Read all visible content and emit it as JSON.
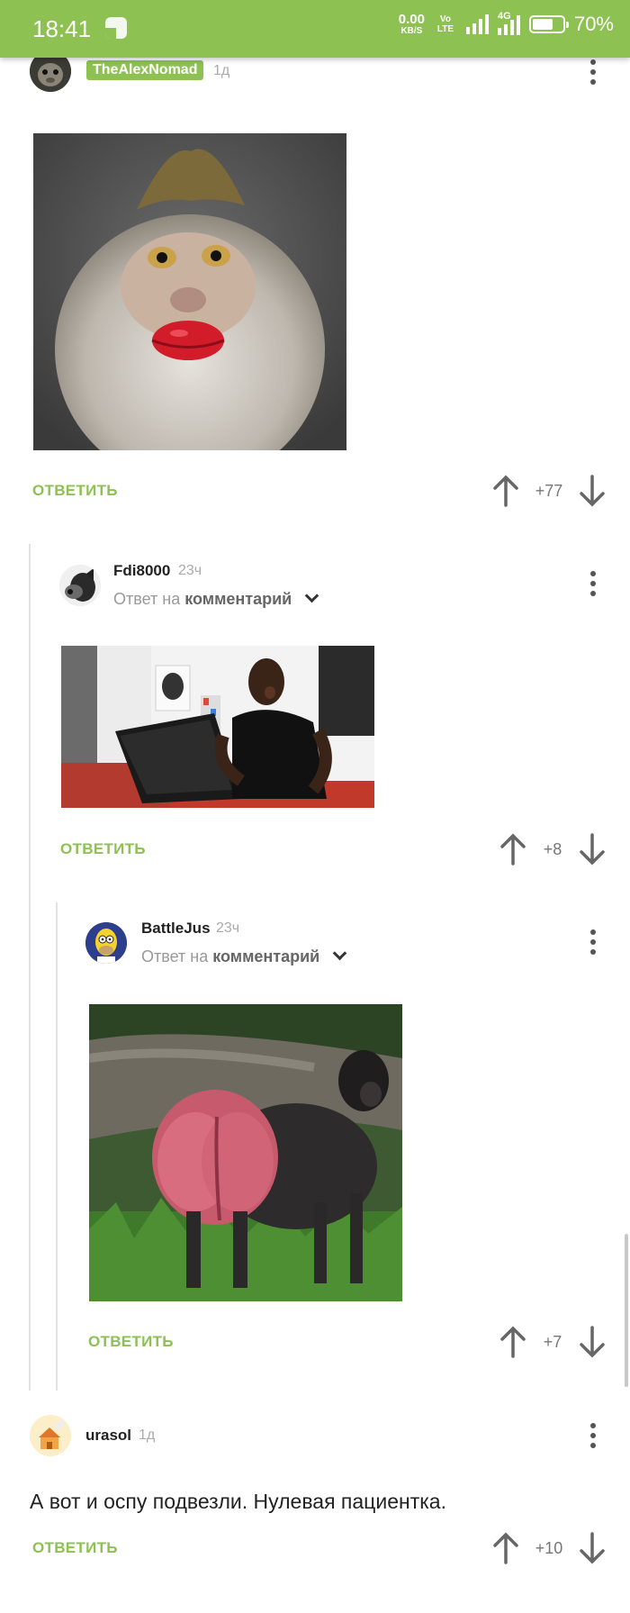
{
  "status_bar": {
    "time": "18:41",
    "net_speed_value": "0.00",
    "net_speed_unit": "KB/S",
    "volte": "Vo LTE",
    "network": "4G",
    "battery_level": 0.7,
    "battery_percent": "70%"
  },
  "comments": [
    {
      "username": "TheAlexNomad",
      "time": "1д",
      "image": "monkey-with-red-lips",
      "reply_label": "ОТВЕТИТЬ",
      "score": "+77"
    },
    {
      "username": "Fdi8000",
      "time": "23ч",
      "reply_to_prefix": "Ответ на",
      "reply_to_link": "комментарий",
      "image": "man-shocked-at-laptop",
      "reply_label": "ОТВЕТИТЬ",
      "score": "+8"
    },
    {
      "username": "BattleJus",
      "time": "23ч",
      "reply_to_prefix": "Ответ на",
      "reply_to_link": "комментарий",
      "image": "baboon-red-rear",
      "reply_label": "ОТВЕТИТЬ",
      "score": "+7"
    },
    {
      "username": "urasol",
      "time": "1д",
      "text": "А вот и оспу подвезли. Нулевая пациентка.",
      "reply_label": "ОТВЕТИТЬ",
      "score": "+10"
    }
  ],
  "icons": {
    "upvote": "arrow-up-icon",
    "downvote": "arrow-down-icon",
    "menu": "kebab-menu-icon",
    "expand": "chevron-down-icon"
  },
  "colors": {
    "accent": "#8dc152",
    "text": "#222222",
    "muted": "#999999"
  }
}
